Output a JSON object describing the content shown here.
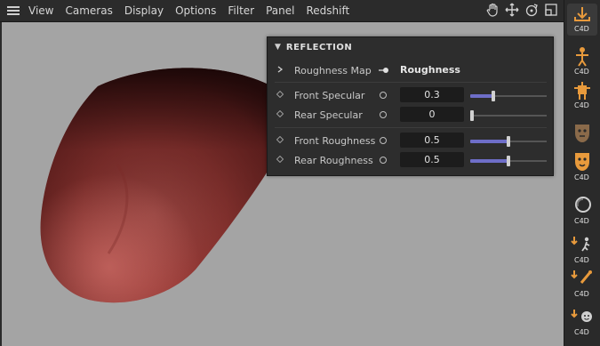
{
  "menu": {
    "items": [
      "View",
      "Cameras",
      "Display",
      "Options",
      "Filter",
      "Panel",
      "Redshift"
    ],
    "right_icons": [
      "hand-pan-icon",
      "move-arrows-icon",
      "orbit-icon",
      "maximize-view-icon"
    ]
  },
  "panel": {
    "title": "REFLECTION",
    "roughness_map": {
      "label": "Roughness Map",
      "value": "Roughness"
    },
    "rows": [
      {
        "label": "Front Specular",
        "value": "0.3",
        "slider": 0.3
      },
      {
        "label": "Rear Specular",
        "value": "0",
        "slider": 0.0
      },
      {
        "label": "Front Roughness",
        "value": "0.5",
        "slider": 0.5
      },
      {
        "label": "Rear Roughness",
        "value": "0.5",
        "slider": 0.5
      }
    ]
  },
  "toolstrip": {
    "tools": [
      {
        "name": "import-asset-tool",
        "label": "C4D"
      },
      {
        "name": "character-rig-tool",
        "label": "C4D"
      },
      {
        "name": "character-pose-tool",
        "label": "C4D"
      },
      {
        "name": "face-mask-tool",
        "label": ""
      },
      {
        "name": "face-mask-orange-tool",
        "label": "C4D"
      },
      {
        "name": "sphere-tool",
        "label": "C4D"
      },
      {
        "name": "walk-animation-tool",
        "label": "C4D"
      },
      {
        "name": "motion-tool",
        "label": "C4D"
      },
      {
        "name": "face-expression-tool",
        "label": "C4D"
      }
    ]
  },
  "colors": {
    "accent_slider": "#6e6ec8",
    "viewport_bg": "#a4a4a4",
    "panel_bg": "#2d2d2d",
    "tool_orange": "#e89a3c"
  }
}
